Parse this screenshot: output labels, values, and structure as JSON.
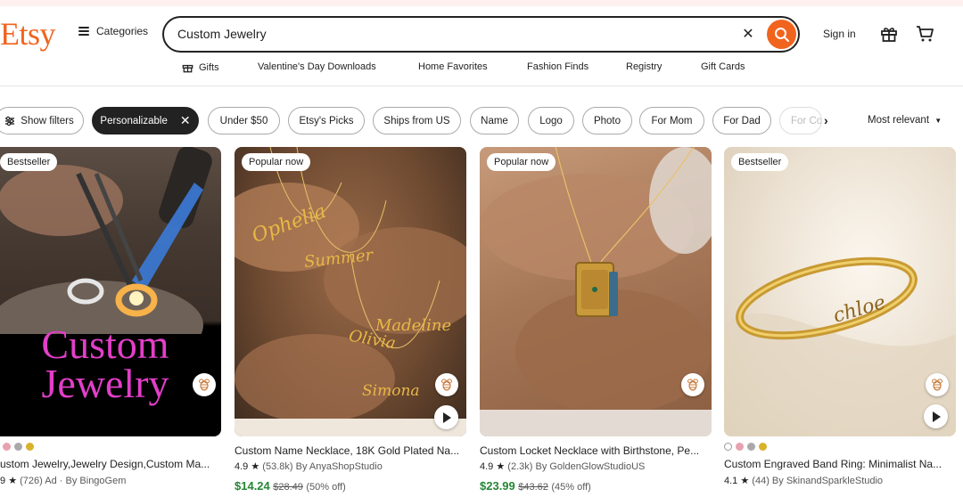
{
  "header": {
    "logo": "Etsy",
    "categories_label": "Categories",
    "search_value": "Custom Jewelry",
    "sign_in": "Sign in"
  },
  "subnav": [
    {
      "label": "Gifts",
      "icon": "gift-icon"
    },
    {
      "label": "Valentine's Day Downloads"
    },
    {
      "label": "Home Favorites"
    },
    {
      "label": "Fashion Finds"
    },
    {
      "label": "Registry"
    },
    {
      "label": "Gift Cards"
    }
  ],
  "filters": {
    "show_filters": "Show filters",
    "chips": [
      "Personalizable",
      "Under $50",
      "Etsy's Picks",
      "Ships from US",
      "Name",
      "Logo",
      "Photo",
      "For Mom",
      "For Dad",
      "For Co"
    ],
    "active_chip": "Personalizable",
    "sort": "Most relevant"
  },
  "products": [
    {
      "badge": "Bestseller",
      "image_text": [
        "Custom",
        "Jewelry"
      ],
      "title": "ustom Jewelry,Jewelry Design,Custom Ma...",
      "rating_prefix": "9",
      "reviews": "(726)",
      "ad": "Ad",
      "shop": "By BingoGem",
      "swatch_colors": [
        "#e7a1b0",
        "#a9a9a9",
        "#d9b12b"
      ]
    },
    {
      "badge": "Popular now",
      "image_text": [
        "Ophelia",
        "Summer",
        "Madeline",
        "Olivia",
        "Simona"
      ],
      "title": "Custom Name Necklace, 18K Gold Plated Na...",
      "rating": "4.9",
      "reviews": "(53.8k)",
      "shop": "By AnyaShopStudio",
      "price": "$14.24",
      "original_price": "$28.49",
      "discount": "(50% off)"
    },
    {
      "badge": "Popular now",
      "title": "Custom Locket Necklace with Birthstone, Pe...",
      "rating": "4.9",
      "reviews": "(2.3k)",
      "shop": "By GoldenGlowStudioUS",
      "price": "$23.99",
      "original_price": "$43.62",
      "discount": "(45% off)"
    },
    {
      "badge": "Bestseller",
      "image_text": [
        "chloe"
      ],
      "title": "Custom Engraved Band Ring: Minimalist Na...",
      "rating": "4.1",
      "reviews": "(44)",
      "shop": "By SkinandSparkleStudio",
      "swatch_colors": [
        "#ffffff",
        "#e7a1b0",
        "#a9a9a9",
        "#d9b12b"
      ]
    }
  ],
  "colors": {
    "brand": "#f1641e",
    "price_green": "#258635"
  }
}
